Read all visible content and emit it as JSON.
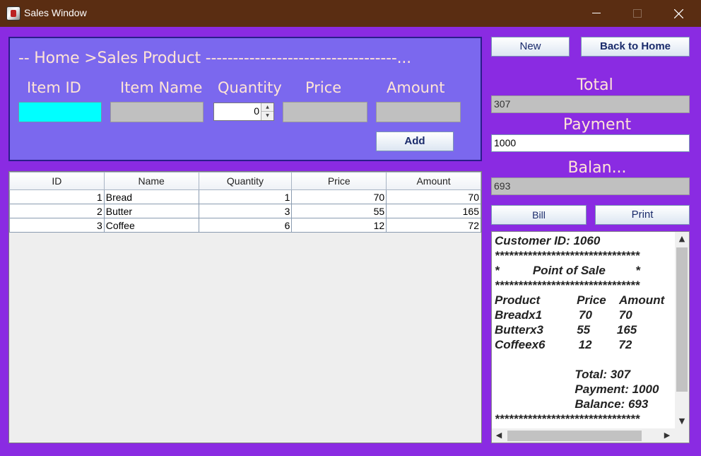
{
  "window": {
    "title": "Sales Window",
    "icon": "java-app-icon"
  },
  "form": {
    "breadcrumb": "-- Home >Sales Product -----------------------------------...",
    "labels": {
      "item_id": "Item ID",
      "item_name": "Item Name",
      "quantity": "Quantity",
      "price": "Price",
      "amount": "Amount"
    },
    "values": {
      "item_id": "",
      "item_name": "",
      "quantity": "0",
      "price": "",
      "amount": ""
    },
    "add_label": "Add"
  },
  "table": {
    "columns": [
      "ID",
      "Name",
      "Quantity",
      "Price",
      "Amount"
    ],
    "rows": [
      [
        "1",
        "Bread",
        "1",
        "70",
        "70"
      ],
      [
        "2",
        "Butter",
        "3",
        "55",
        "165"
      ],
      [
        "3",
        "Coffee",
        "6",
        "12",
        "72"
      ]
    ]
  },
  "actions": {
    "new_label": "New",
    "back_label": "Back to Home",
    "bill_label": "Bill",
    "print_label": "Print"
  },
  "summary": {
    "total_label": "Total",
    "total_value": "307",
    "payment_label": "Payment",
    "payment_value": "1000",
    "balance_label": "Balan...",
    "balance_value": "693"
  },
  "receipt": {
    "lines": [
      "Customer ID: 1060",
      "*******************************",
      "*          Point of Sale         *",
      "*******************************",
      "Product           Price    Amount",
      "Breadx1           70        70",
      "Butterx3          55        165",
      "Coffeex6          12        72",
      "",
      "                        Total: 307",
      "                        Payment: 1000",
      "                        Balance: 693",
      "*******************************"
    ]
  },
  "colors": {
    "window_bg": "#8a2be2",
    "panel_bg": "#7b68ee",
    "titlebar_bg": "#5a2d12",
    "label_color": "#ffe4d6",
    "item_id_field": "#00ffff"
  }
}
